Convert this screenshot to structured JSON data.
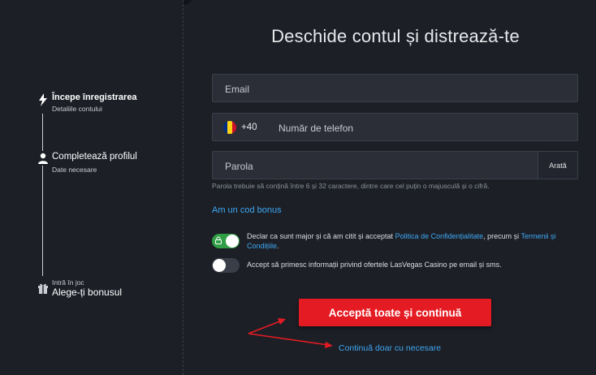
{
  "heading": "Deschide contul și distrează-te",
  "steps": [
    {
      "title": "Începe înregistrarea",
      "subtitle": "Detaliile contului",
      "icon": "lightning-icon"
    },
    {
      "title": "Completează profilul",
      "subtitle": "Date necesare",
      "icon": "user-icon"
    },
    {
      "title": "Alege-ți bonusul",
      "subtitle": "Intră în joc",
      "icon": "gift-icon"
    }
  ],
  "form": {
    "email_placeholder": "Email",
    "phone_prefix": "+40",
    "phone_placeholder": "Număr de telefon",
    "password_placeholder": "Parola",
    "show_password_label": "Arată",
    "password_hint": "Parola trebuie să conțină între 6 și 32 caractere, dintre care cel puțin o majusculă și o cifră.",
    "bonus_code_link": "Am un cod bonus"
  },
  "consents": {
    "legal_text_before": "Declar ca sunt major și că am citit și acceptat ",
    "privacy_link": "Politica de Confidențialitate",
    "legal_text_middle": ", precum și ",
    "terms_link": "Termenii și Condițiile",
    "legal_text_after": ".",
    "legal_enabled": true,
    "marketing_text": "Accept să primesc informații privind ofertele LasVegas Casino pe email și sms.",
    "marketing_enabled": false
  },
  "actions": {
    "accept_all": "Acceptă toate și continuă",
    "continue_necessary": "Continuă doar cu necesare"
  },
  "colors": {
    "background": "#1c1f26",
    "field": "#2b2e37",
    "accent_red": "#e51b23",
    "link_blue": "#3fa9f5",
    "toggle_on": "#2f9e44",
    "annotation_arrow": "#e51b23"
  }
}
